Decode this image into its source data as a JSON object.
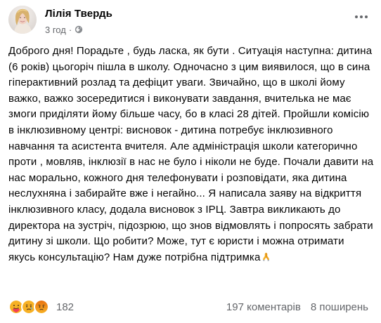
{
  "post": {
    "author": "Лілія Твердь",
    "time": "3 год",
    "separator": "·",
    "privacy_icon": "globe-icon",
    "more_icon": "more-horizontal-icon",
    "text": "Доброго дня! Порадьте , будь ласка, як бути . Ситуація наступна: дитина (6 років) цьогоріч пішла в школу. Одночасно з цим виявилося, що в сина гіперактивний розлад та дефіцит уваги. Звичайно, що в школі йому важко, важко зосередитися і виконувати завдання, вчителька не має змоги приділяти йому більше часу, бо в класі 28 дітей. Пройшли комісію в інклюзивному центрі: висновок - дитина потребує інклюзивного навчання та асистента вчителя. Але адміністрація школи категорично проти , мовляв, інклюзії в нас не було і ніколи не буде. Почали давити на нас морально, кожного дня телефонувати і розповідати, яка дитина неслухняна і забирайте вже і негайно... Я написала заяву на відкриття інклюзивного класу, додала висновок з ІРЦ. Завтра викликають до директора на зустріч, підозрюю, що знов відмовлять і попросять забрати дитину зі школи. Що робити? Може, тут є юристи і можна отримати якусь консультацію? Нам дуже потрібна підтримка",
    "text_end_emoji": "folded-hands-emoji"
  },
  "footer": {
    "reactions": [
      "care-reaction-icon",
      "sad-reaction-icon",
      "angry-reaction-icon"
    ],
    "reaction_count": "182",
    "comments": "197 коментарів",
    "shares": "8 поширень"
  },
  "colors": {
    "text": "#050505",
    "secondary_text": "#65676b",
    "reaction_yellow": "#f7b125",
    "reaction_red": "#e9710f"
  }
}
